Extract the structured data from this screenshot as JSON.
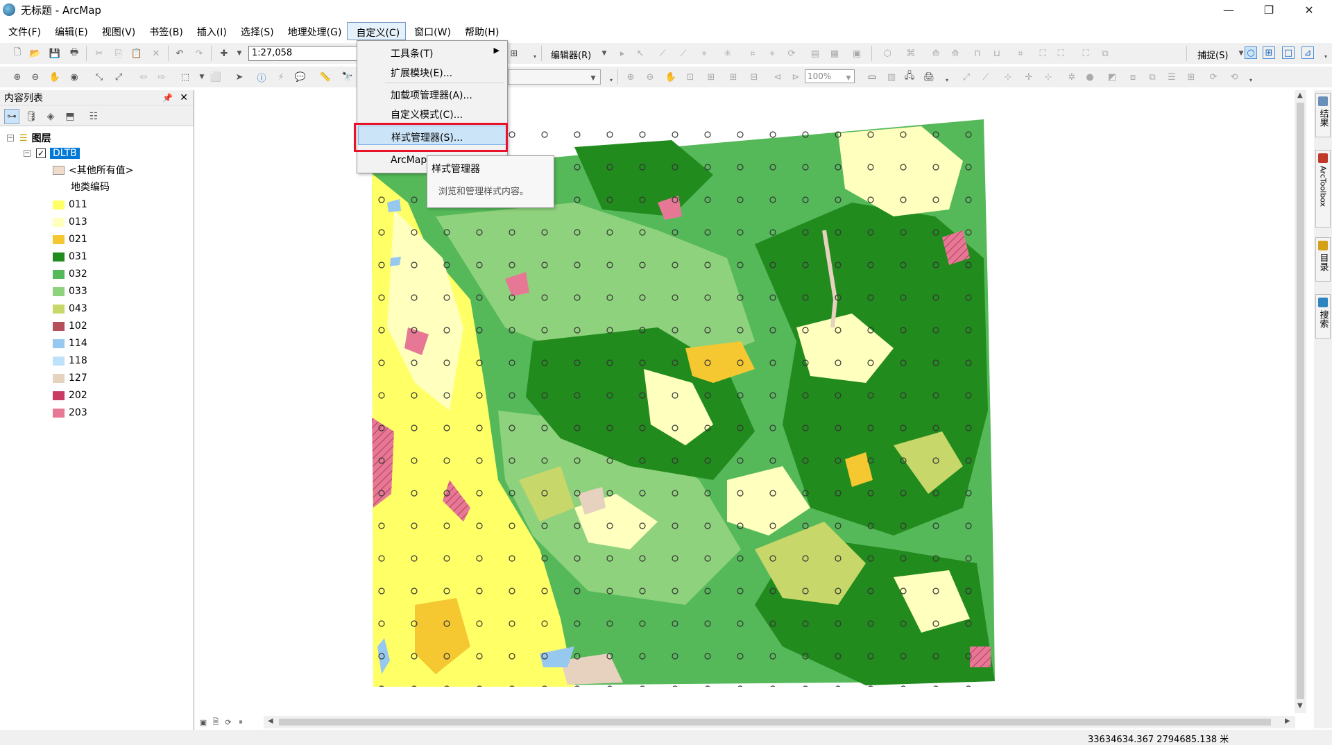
{
  "window": {
    "title": "无标题 - ArcMap",
    "controls": [
      "—",
      "❐",
      "✕"
    ]
  },
  "menubar": [
    {
      "label": "文件(F)"
    },
    {
      "label": "编辑(E)"
    },
    {
      "label": "视图(V)"
    },
    {
      "label": "书签(B)"
    },
    {
      "label": "插入(I)"
    },
    {
      "label": "选择(S)"
    },
    {
      "label": "地理处理(G)"
    },
    {
      "label": "自定义(C)",
      "active": true
    },
    {
      "label": "窗口(W)"
    },
    {
      "label": "帮助(H)"
    }
  ],
  "toolbar": {
    "scale": "1:27,058",
    "editor_label": "编辑器(R)",
    "snapping_label": "捕捉(S)",
    "zoom_percent": "100%"
  },
  "dropdown": {
    "items": [
      {
        "label": "工具条(T)",
        "submenu": true
      },
      {
        "label": "扩展模块(E)..."
      },
      {
        "label": "加载项管理器(A)..."
      },
      {
        "label": "自定义模式(C)..."
      },
      {
        "label": "样式管理器(S)...",
        "hover": true
      },
      {
        "label": "ArcMap"
      }
    ]
  },
  "tooltip": {
    "title": "样式管理器",
    "description": "浏览和管理样式内容。"
  },
  "toc": {
    "title": "内容列表",
    "root_label": "图层",
    "layer_name": "DLTB",
    "other_values": "<其他所有值>",
    "field_heading": "地类编码",
    "legend": [
      {
        "code": "011",
        "color": "#ffff66"
      },
      {
        "code": "013",
        "color": "#ffffbe"
      },
      {
        "code": "021",
        "color": "#f5c832"
      },
      {
        "code": "031",
        "color": "#228b1e"
      },
      {
        "code": "032",
        "color": "#55b95a"
      },
      {
        "code": "033",
        "color": "#8fd27d"
      },
      {
        "code": "043",
        "color": "#c8d769"
      },
      {
        "code": "102",
        "color": "#b4505a"
      },
      {
        "code": "114",
        "color": "#96c8f0"
      },
      {
        "code": "118",
        "color": "#bee1fa"
      },
      {
        "code": "127",
        "color": "#e6d2be"
      },
      {
        "code": "202",
        "color": "#c83c64"
      },
      {
        "code": "203",
        "color": "#e67896"
      }
    ],
    "other_color": "#f0dcc8"
  },
  "status": {
    "coordinates": "33634634.367  2794685.138 米"
  },
  "right_dock": [
    "结果",
    "ArcToolbox",
    "目录",
    "搜索"
  ]
}
